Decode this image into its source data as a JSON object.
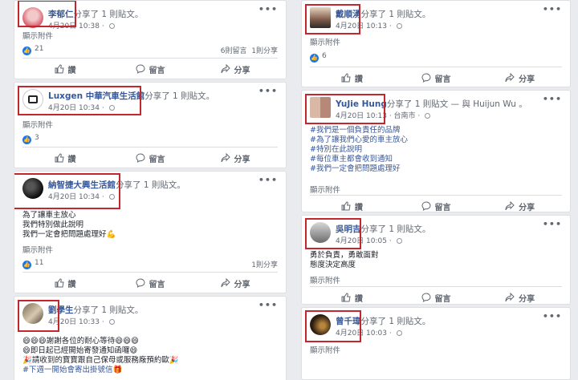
{
  "posts": {
    "li": {
      "name": "李郁仁",
      "shared": "分享了 1 則貼文。",
      "time": "4月20日 10:38 · ",
      "attach": "顯示附件",
      "reactions": "21",
      "comments": "6則留言",
      "shares": "1則分享"
    },
    "luxgen": {
      "name": "Luxgen 中華汽車生活館",
      "shared": "分享了 1 則貼文。",
      "time": "4月20日 10:34 · ",
      "attach": "顯示附件",
      "reactions": "3"
    },
    "nazhi": {
      "name": "納智捷大興生活館",
      "shared": "分享了 1 則貼文。",
      "time": "4月20日 10:34 · ",
      "body": [
        "為了讓車主放心",
        "我們特別做此說明",
        "我們一定會把問題處理好💪"
      ],
      "attach": "顯示附件",
      "reactions": "11",
      "shares": "1則分享"
    },
    "liu": {
      "name": "劉學生",
      "shared": "分享了 1 則貼文。",
      "time": "4月20日 10:33 · ",
      "body": [
        "😄😄😄謝謝各位的耐心等待😄😄😄",
        "😄即日起已經開始寄發通知函囉😄",
        "🎉請收到的寶寶跟自己保母或服務廠預約歐🎉",
        "#下週一開始會寄出掛號信🎁"
      ]
    },
    "dai": {
      "name": "戴順湧",
      "shared": "分享了 1 則貼文。",
      "time": "4月20日 10:13 · ",
      "attach": "顯示附件",
      "reactions": "6"
    },
    "yujie": {
      "name": "YuJie Hung",
      "shared": "分享了 1 則貼文 — 與 Huijun Wu 。",
      "time": "4月20日 10:13 · 台南市 · ",
      "body": [
        "#我們是一個負責任的品牌",
        "#為了讓我們心愛的車主放心",
        "#特別在此說明",
        "#每位車主都會收到通知",
        "#我們一定會把問題處理好"
      ],
      "attach": "顯示附件"
    },
    "wu": {
      "name": "吳明吉",
      "shared": "分享了 1 則貼文。",
      "time": "4月20日 10:05 · ",
      "body": [
        "勇於負責，勇敢面對",
        "態度決定高度"
      ],
      "attach": "顯示附件"
    },
    "zeng": {
      "name": "曾千瑋",
      "shared": "分享了 1 則貼文。",
      "time": "4月20日 10:03 · ",
      "attach": "顯示附件"
    }
  },
  "actions": {
    "like": "讚",
    "comment": "留言",
    "share": "分享"
  },
  "colors": {
    "highlight": "#c4262e",
    "link": "#365899",
    "like": "#1877f2"
  },
  "icons": [
    "more-icon",
    "globe-icon",
    "like-icon",
    "comment-icon",
    "share-icon"
  ]
}
